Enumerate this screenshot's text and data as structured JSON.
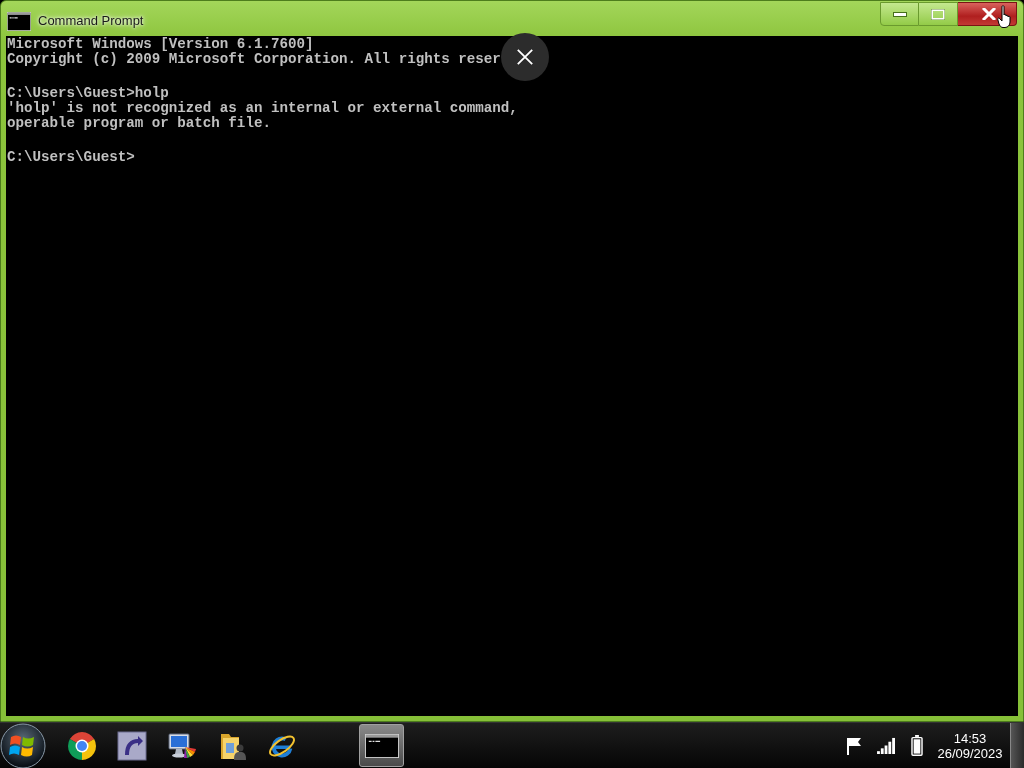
{
  "window": {
    "title": "Command Prompt"
  },
  "console": {
    "blocks": [
      {
        "lines": [
          "Microsoft Windows [Version 6.1.7600]",
          "Copyright (c) 2009 Microsoft Corporation. All rights reser"
        ]
      },
      {
        "lines": [
          "C:\\Users\\Guest>holp",
          "'holp' is not recognized as an internal or external command,",
          "operable program or batch file."
        ]
      },
      {
        "lines": [
          "C:\\Users\\Guest>"
        ]
      }
    ]
  },
  "taskbar": {
    "pinned": [
      {
        "kind": "browser"
      },
      {
        "kind": "shortcut"
      },
      {
        "kind": "display"
      },
      {
        "kind": "folder"
      },
      {
        "kind": "web"
      }
    ],
    "running": [
      {
        "kind": "console",
        "active": true
      }
    ],
    "clock": {
      "time": "14:53",
      "date": "26/09/2023"
    }
  }
}
